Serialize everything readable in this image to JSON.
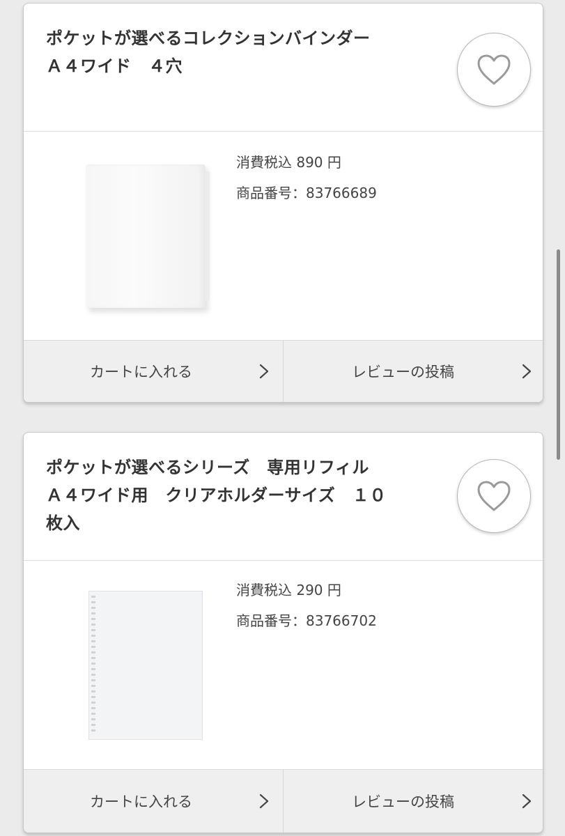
{
  "products": [
    {
      "title_lines": [
        "ポケットが選べるコレクションバインダー",
        "Ａ４ワイド　４穴"
      ],
      "price_line": "消費税込 890 円",
      "item_number_line": "商品番号：83766689",
      "image": "binder",
      "favorite_icon": "heart-outline-icon",
      "actions": [
        {
          "label": "カートに入れる",
          "icon": "chevron-right-icon"
        },
        {
          "label": "レビューの投稿",
          "icon": "chevron-right-icon"
        }
      ]
    },
    {
      "title_lines": [
        "ポケットが選べるシリーズ　専用リフィル",
        "Ａ４ワイド用　クリアホルダーサイズ　１０",
        "枚入"
      ],
      "price_line": "消費税込 290 円",
      "item_number_line": "商品番号：83766702",
      "image": "refill",
      "favorite_icon": "heart-outline-icon",
      "actions": [
        {
          "label": "カートに入れる",
          "icon": "chevron-right-icon"
        },
        {
          "label": "レビューの投稿",
          "icon": "chevron-right-icon"
        }
      ]
    }
  ]
}
